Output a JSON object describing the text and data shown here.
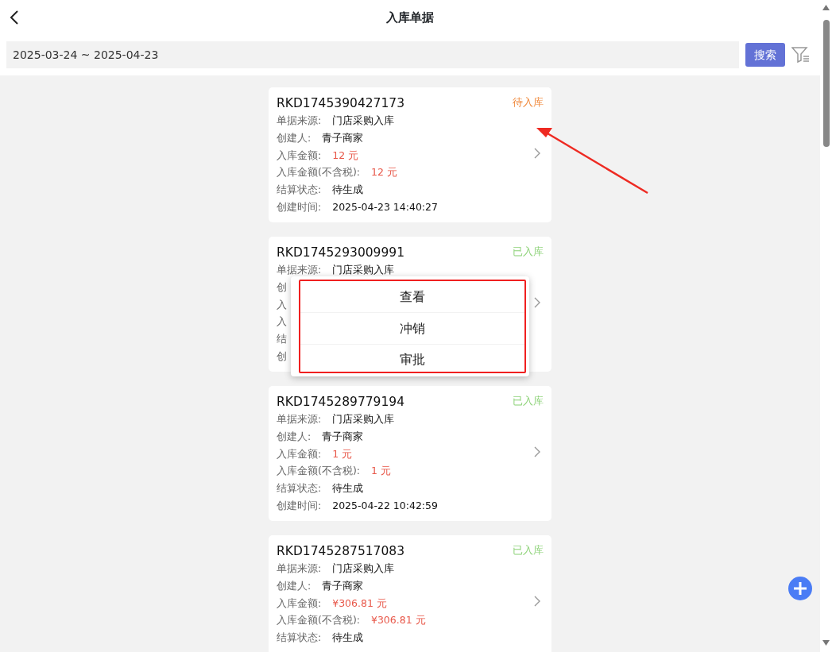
{
  "header": {
    "title": "入库单据"
  },
  "search": {
    "value": "2025-03-24 ~ 2025-04-23",
    "button": "搜索"
  },
  "orders": [
    {
      "number": "RKD1745390427173",
      "status": {
        "text": "待入库",
        "kind": "pending"
      },
      "rows": [
        {
          "label": "单据来源:",
          "value": "门店采购入库",
          "kind": "plain"
        },
        {
          "label": "创建人:",
          "value": "青子商家",
          "kind": "plain"
        },
        {
          "label": "入库金额:",
          "value": "12 元",
          "kind": "amount"
        },
        {
          "label": "入库金额(不含税):",
          "value": "12 元",
          "kind": "amount"
        },
        {
          "label": "结算状态:",
          "value": "待生成",
          "kind": "plain"
        },
        {
          "label": "创建时间:",
          "value": "2025-04-23 14:40:27",
          "kind": "plain"
        }
      ]
    },
    {
      "number": "RKD1745293009991",
      "status": {
        "text": "已入库",
        "kind": "done"
      },
      "rows": [
        {
          "label": "单据来源:",
          "value": "门店采购入库",
          "kind": "plain"
        },
        {
          "label": "创"
        },
        {
          "label": "入"
        },
        {
          "label": "入"
        },
        {
          "label": "结"
        },
        {
          "label": "创"
        }
      ],
      "menu": {
        "items": [
          "查看",
          "冲销",
          "审批"
        ]
      }
    },
    {
      "number": "RKD1745289779194",
      "status": {
        "text": "已入库",
        "kind": "done"
      },
      "rows": [
        {
          "label": "单据来源:",
          "value": "门店采购入库",
          "kind": "plain"
        },
        {
          "label": "创建人:",
          "value": "青子商家",
          "kind": "plain"
        },
        {
          "label": "入库金额:",
          "value": "1 元",
          "kind": "amount"
        },
        {
          "label": "入库金额(不含税):",
          "value": "1 元",
          "kind": "amount"
        },
        {
          "label": "结算状态:",
          "value": "待生成",
          "kind": "plain"
        },
        {
          "label": "创建时间:",
          "value": "2025-04-22 10:42:59",
          "kind": "plain"
        }
      ]
    },
    {
      "number": "RKD1745287517083",
      "status": {
        "text": "已入库",
        "kind": "done"
      },
      "rows": [
        {
          "label": "单据来源:",
          "value": "门店采购入库",
          "kind": "plain"
        },
        {
          "label": "创建人:",
          "value": "青子商家",
          "kind": "plain"
        },
        {
          "label": "入库金额:",
          "value": "¥306.81 元",
          "kind": "amount"
        },
        {
          "label": "入库金额(不含税):",
          "value": "¥306.81 元",
          "kind": "amount"
        },
        {
          "label": "结算状态:",
          "value": "待生成",
          "kind": "plain"
        }
      ]
    }
  ]
}
